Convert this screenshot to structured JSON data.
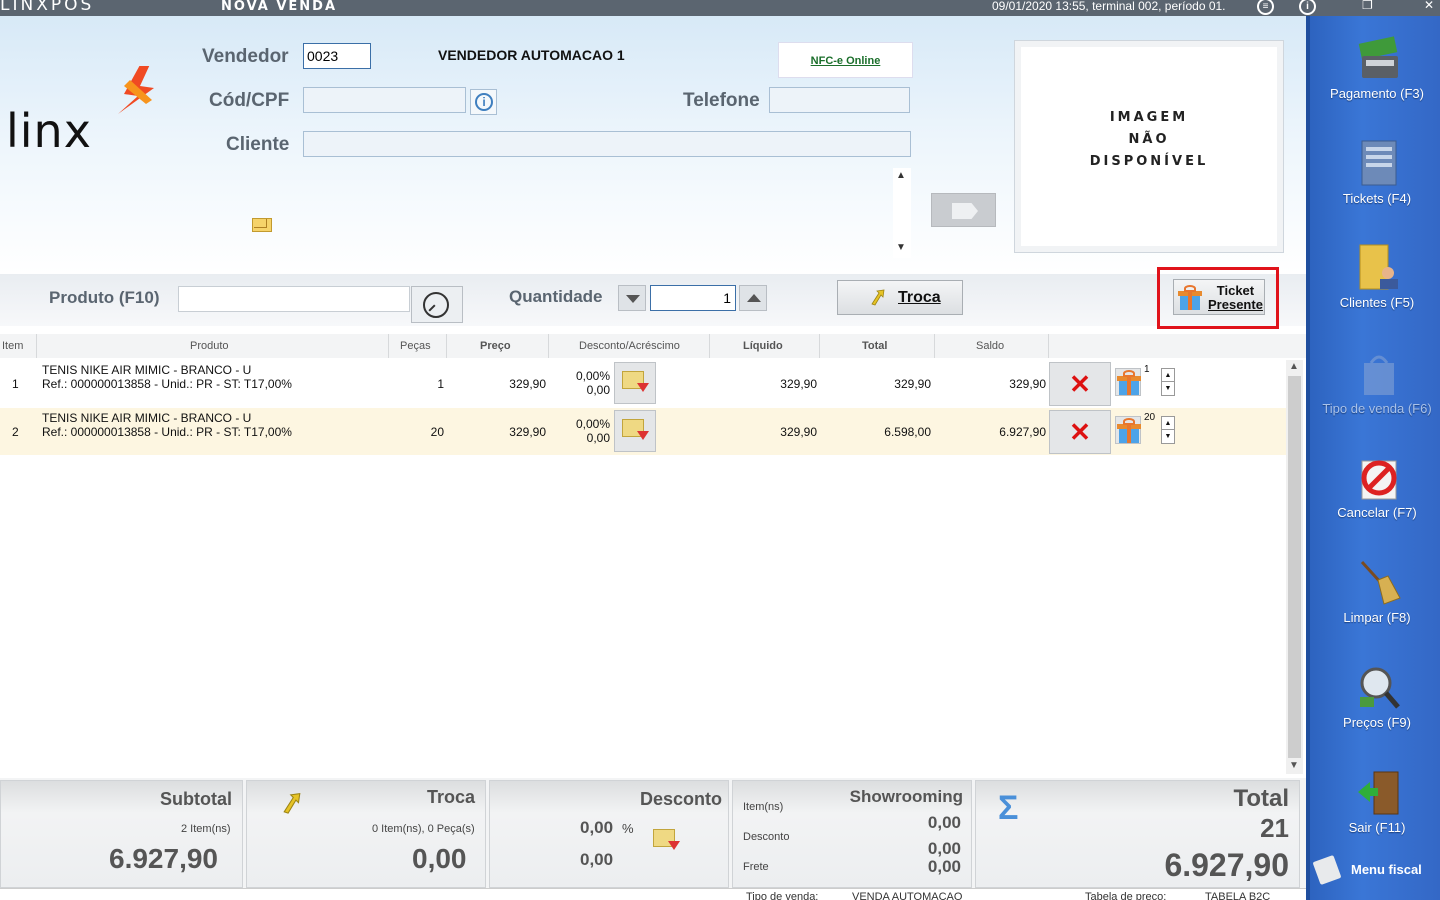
{
  "titlebar": {
    "app_name": "LINXPOS",
    "window_title": "Nova venda",
    "status": "09/01/2020 13:55, terminal 002, período 01."
  },
  "header": {
    "logo_text": "linx",
    "vendedor_label": "Vendedor",
    "vendedor_value": "0023",
    "vendedor_name": "VENDEDOR AUTOMACAO 1",
    "nfce_label": "NFC-e Online",
    "cpf_label": "Cód/CPF",
    "cpf_value": "",
    "telefone_label": "Telefone",
    "telefone_value": "",
    "cliente_label": "Cliente",
    "cliente_value": "",
    "image_placeholder": [
      "IMAGEM",
      "NÃO",
      "DISPONÍVEL"
    ]
  },
  "productbar": {
    "produto_label": "Produto (F10)",
    "produto_value": "",
    "quantidade_label": "Quantidade",
    "quantidade_value": "1",
    "troca_label": "Troca",
    "ticket_label_1": "Ticket",
    "ticket_label_2": "Presente"
  },
  "table": {
    "columns": [
      "Item",
      "Produto",
      "Peças",
      "Preço",
      "Desconto/Acréscimo",
      "Líquido",
      "Total",
      "Saldo"
    ],
    "rows": [
      {
        "item": "1",
        "produto_line1": "TENIS NIKE AIR MIMIC - BRANCO - U",
        "produto_line2": "Ref.: 000000013858 - Unid.: PR - ST: T17,00%",
        "pecas": "1",
        "preco": "329,90",
        "desconto_pct": "0,00%",
        "desconto_val": "0,00",
        "liquido": "329,90",
        "total": "329,90",
        "saldo": "329,90",
        "gift_count": "1"
      },
      {
        "item": "2",
        "produto_line1": "TENIS NIKE AIR MIMIC - BRANCO - U",
        "produto_line2": "Ref.: 000000013858 - Unid.: PR - ST: T17,00%",
        "pecas": "20",
        "preco": "329,90",
        "desconto_pct": "0,00%",
        "desconto_val": "0,00",
        "liquido": "329,90",
        "total": "6.598,00",
        "saldo": "6.927,90",
        "gift_count": "20"
      }
    ]
  },
  "totals": {
    "subtotal_label": "Subtotal",
    "subtotal_items": "2 Item(ns)",
    "subtotal_value": "6.927,90",
    "troca_label": "Troca",
    "troca_items": "0 Item(ns), 0 Peça(s)",
    "troca_value": "0,00",
    "desconto_label": "Desconto",
    "desconto_pct": "0,00",
    "desconto_pct_sign": "%",
    "desconto_value": "0,00",
    "showrooming_label": "Showrooming",
    "showrooming_items_label": "Item(ns)",
    "showrooming_items": "0,00",
    "showrooming_desconto_label": "Desconto",
    "showrooming_desconto": "0,00",
    "showrooming_frete_label": "Frete",
    "showrooming_frete": "0,00",
    "total_label": "Total",
    "total_qty": "21",
    "total_value": "6.927,90"
  },
  "statusline": {
    "tipo_label": "Tipo de venda:",
    "tipo_value": "VENDA AUTOMACAO",
    "tabela_label": "Tabela de preço:",
    "tabela_value": "TABELA B2C"
  },
  "sidebar": {
    "items": [
      {
        "label": "Pagamento (F3)",
        "icon": "money-icon"
      },
      {
        "label": "Tickets (F4)",
        "icon": "tickets-icon"
      },
      {
        "label": "Clientes (F5)",
        "icon": "clients-icon"
      },
      {
        "label": "Tipo de venda (F6)",
        "icon": "bag-icon"
      },
      {
        "label": "Cancelar (F7)",
        "icon": "cancel-icon"
      },
      {
        "label": "Limpar (F8)",
        "icon": "broom-icon"
      },
      {
        "label": "Preços (F9)",
        "icon": "magnifier-icon"
      },
      {
        "label": "Sair (F11)",
        "icon": "exit-door-icon"
      }
    ],
    "menu_fiscal": "Menu fiscal"
  }
}
